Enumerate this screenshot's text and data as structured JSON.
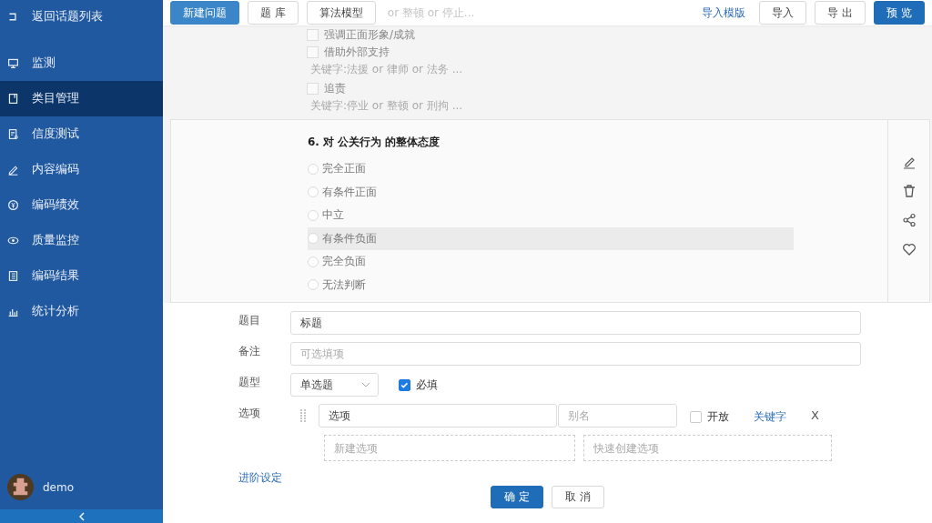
{
  "sidebar": {
    "back": {
      "label": "返回话题列表"
    },
    "items": [
      {
        "label": "监测",
        "selected": false
      },
      {
        "label": "类目管理",
        "selected": true
      },
      {
        "label": "信度测试",
        "selected": false
      },
      {
        "label": "内容编码",
        "selected": false
      },
      {
        "label": "编码绩效",
        "selected": false
      },
      {
        "label": "质量监控",
        "selected": false
      },
      {
        "label": "编码结果",
        "selected": false
      },
      {
        "label": "统计分析",
        "selected": false
      }
    ],
    "user": {
      "name": "demo"
    }
  },
  "toolbar": {
    "buttons": [
      {
        "label": "新建问题",
        "primary": true
      },
      {
        "label": "题 库",
        "primary": false
      },
      {
        "label": "算法模型",
        "primary": false
      }
    ],
    "import_template": "导入模版",
    "right_buttons": [
      {
        "label": "导入",
        "primary": false
      },
      {
        "label": "导 出",
        "primary": false
      },
      {
        "label": "预 览",
        "primary": true
      }
    ]
  },
  "background_list": {
    "partial_keyword": "or 整顿 or 停止...",
    "items": [
      {
        "label": "强调正面形象/成就",
        "checked": false
      },
      {
        "label": "借助外部支持",
        "checked": false,
        "keywords": "关键字:法援 or 律师 or 法务 ..."
      },
      {
        "label": "追责",
        "checked": false,
        "keywords": "关键字:停业 or 整顿 or 刑拘 ..."
      }
    ]
  },
  "question": {
    "title": "6. 对 公关行为 的整体态度",
    "options": [
      {
        "label": "完全正面",
        "selected": false,
        "highlighted": false
      },
      {
        "label": "有条件正面",
        "selected": false,
        "highlighted": false
      },
      {
        "label": "中立",
        "selected": false,
        "highlighted": false
      },
      {
        "label": "有条件负面",
        "selected": false,
        "highlighted": true
      },
      {
        "label": "完全负面",
        "selected": false,
        "highlighted": false
      },
      {
        "label": "无法判断",
        "selected": false,
        "highlighted": false
      }
    ]
  },
  "form": {
    "title": {
      "label": "题目",
      "value": "标题"
    },
    "note": {
      "label": "备注",
      "placeholder": "可选填项"
    },
    "type": {
      "label": "题型",
      "value": "单选题"
    },
    "required": {
      "label": "必填",
      "checked": true
    },
    "options": {
      "label": "选项",
      "rows": [
        {
          "value": "选项",
          "alias_placeholder": "别名",
          "open": {
            "label": "开放",
            "checked": false
          },
          "keyword_link": "关键字",
          "remove": "X"
        }
      ]
    },
    "new_option_placeholder": "新建选项",
    "quick_create_placeholder": "快速创建选项",
    "advanced_link": "进阶设定",
    "confirm": "确 定",
    "cancel": "取 消"
  }
}
